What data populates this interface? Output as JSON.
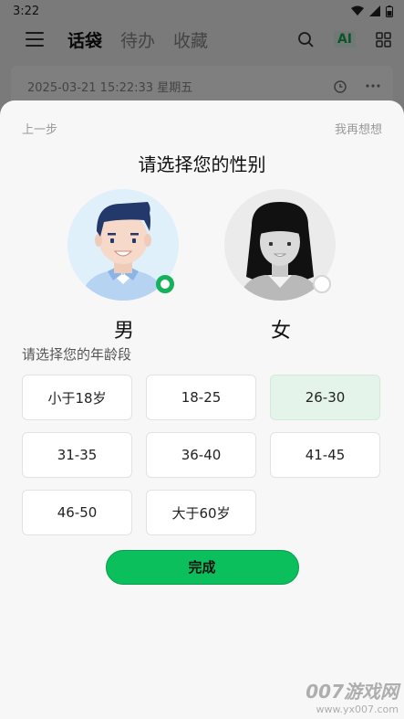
{
  "status_bar": {
    "time": "3:22"
  },
  "header": {
    "tabs": [
      {
        "label": "话袋",
        "active": true
      },
      {
        "label": "待办",
        "active": false
      },
      {
        "label": "收藏",
        "active": false
      }
    ],
    "ai_label": "AI"
  },
  "note": {
    "datetime": "2025-03-21 15:22:33 星期五"
  },
  "sheet": {
    "back_label": "上一步",
    "skip_label": "我再想想",
    "title": "请选择您的性别",
    "genders": [
      {
        "label": "男",
        "selected": true
      },
      {
        "label": "女",
        "selected": false
      }
    ],
    "age_title": "请选择您的年龄段",
    "ages": [
      {
        "label": "小于18岁",
        "selected": false
      },
      {
        "label": "18-25",
        "selected": false
      },
      {
        "label": "26-30",
        "selected": true
      },
      {
        "label": "31-35",
        "selected": false
      },
      {
        "label": "36-40",
        "selected": false
      },
      {
        "label": "41-45",
        "selected": false
      },
      {
        "label": "46-50",
        "selected": false
      },
      {
        "label": "大于60岁",
        "selected": false
      }
    ],
    "done_label": "完成"
  },
  "watermark": {
    "brand": "007游戏网",
    "url": "www.yx007.com"
  },
  "colors": {
    "accent": "#0bbf5c",
    "selected_bg": "#e4f4ea"
  }
}
